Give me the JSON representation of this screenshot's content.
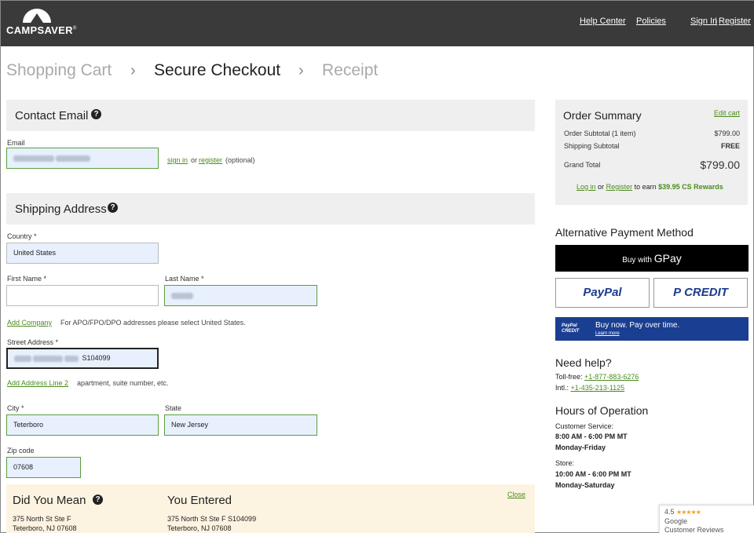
{
  "header": {
    "brand": "CAMPSAVER",
    "brand_mark": "®",
    "help_center": "Help Center",
    "policies": "Policies",
    "sign_in": "Sign In",
    "divider": "|",
    "register": "Register"
  },
  "breadcrumb": {
    "step1": "Shopping Cart",
    "step2": "Secure Checkout",
    "step3": "Receipt",
    "arrow": "›"
  },
  "contact": {
    "heading": "Contact Email",
    "help_glyph": "?",
    "email_label": "Email",
    "sign_in": "sign in",
    "or": "or",
    "register": "register",
    "optional": "(optional)"
  },
  "shipping": {
    "heading": "Shipping Address",
    "help_glyph": "?",
    "country_label": "Country *",
    "country_value": "United States",
    "first_name_label": "First Name *",
    "last_name_label": "Last Name *",
    "add_company": "Add Company",
    "apo_note": "For APO/FPO/DPO addresses please select United States.",
    "street_label": "Street Address *",
    "street_suffix": "S104099",
    "add_line2": "Add Address Line 2",
    "line2_note": "apartment, suite number, etc.",
    "city_label": "City *",
    "city_value": "Teterboro",
    "state_label": "State",
    "state_value": "New Jersey",
    "zip_label": "Zip code",
    "zip_value": "07608"
  },
  "suggestion": {
    "did_you_mean": "Did You Mean",
    "help_glyph": "?",
    "you_entered": "You Entered",
    "close": "Close",
    "suggest_line1": "375 North St Ste F",
    "suggest_line2": "Teterboro, NJ 07608",
    "entered_line1": "375 North St Ste F S104099",
    "entered_line2": "Teterboro, NJ 07608"
  },
  "summary": {
    "title": "Order Summary",
    "edit_cart": "Edit cart",
    "subtotal_label": "Order Subtotal (1 item)",
    "subtotal_value": "$799.00",
    "shipping_label": "Shipping Subtotal",
    "shipping_value": "FREE",
    "grand_label": "Grand Total",
    "grand_value": "$799.00",
    "log_in": "Log in",
    "or": "or",
    "register": "Register",
    "to_earn": "to earn",
    "rewards": "$39.95 CS Rewards"
  },
  "payment": {
    "title": "Alternative Payment Method",
    "gpay_prefix": "Buy with",
    "gpay_g": "G",
    "gpay_pay": "Pay",
    "paypal": "PayPal",
    "credit": "CREDIT",
    "credit_glyph": "P",
    "banner_logo_1": "PayPal",
    "banner_logo_2": "CREDIT",
    "banner_msg": "Buy now. Pay over time.",
    "banner_learn": "Learn more"
  },
  "help": {
    "title": "Need help?",
    "tollfree_label": "Toll-free:",
    "tollfree": "+1-877-883-6276",
    "intl_label": "Intl.:",
    "intl": "+1-435-213-1125"
  },
  "hours": {
    "title": "Hours of Operation",
    "cs_label": "Customer Service:",
    "cs_time": "8:00 AM - 6:00 PM MT",
    "cs_days": "Monday-Friday",
    "store_label": "Store:",
    "store_time": "10:00 AM - 6:00 PM MT",
    "store_days": "Monday-Saturday"
  },
  "reviews": {
    "rating": "4.5",
    "stars": "★★★★★",
    "line1": "Google",
    "line2": "Customer Reviews"
  },
  "colors": {
    "header_bg": "#3a3a3a",
    "link_green": "#4b8b1e",
    "total_red": "#d24a1b",
    "paypal_blue": "#1a3e91"
  }
}
